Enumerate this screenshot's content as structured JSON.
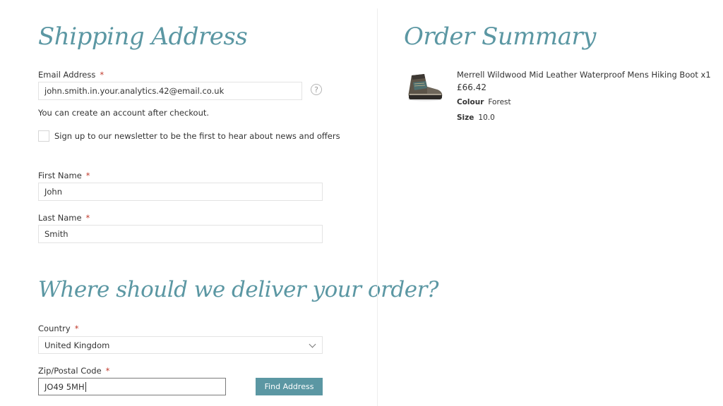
{
  "shipping": {
    "heading": "Shipping Address",
    "email_label": "Email Address",
    "email_value": "john.smith.in.your.analytics.42@email.co.uk",
    "help_glyph": "?",
    "account_note": "You can create an account after checkout.",
    "newsletter_label": "Sign up to our newsletter to be the first to hear about news and offers",
    "newsletter_checked": false,
    "first_name_label": "First Name",
    "first_name_value": "John",
    "last_name_label": "Last Name",
    "last_name_value": "Smith",
    "required_mark": "*"
  },
  "delivery": {
    "heading": "Where should we deliver your order?",
    "country_label": "Country",
    "country_value": "United Kingdom",
    "zip_label": "Zip/Postal Code",
    "zip_value": "JO49 5MH",
    "find_button": "Find Address"
  },
  "summary": {
    "heading": "Order Summary",
    "item": {
      "name": "Merrell Wildwood Mid Leather Waterproof Mens Hiking Boot x1",
      "price": "£66.42",
      "colour_label": "Colour",
      "colour_value": "Forest",
      "size_label": "Size",
      "size_value": "10.0"
    }
  },
  "colors": {
    "accent": "#5b97a3",
    "required": "#c0392b",
    "field_border": "#e3e3e3"
  }
}
